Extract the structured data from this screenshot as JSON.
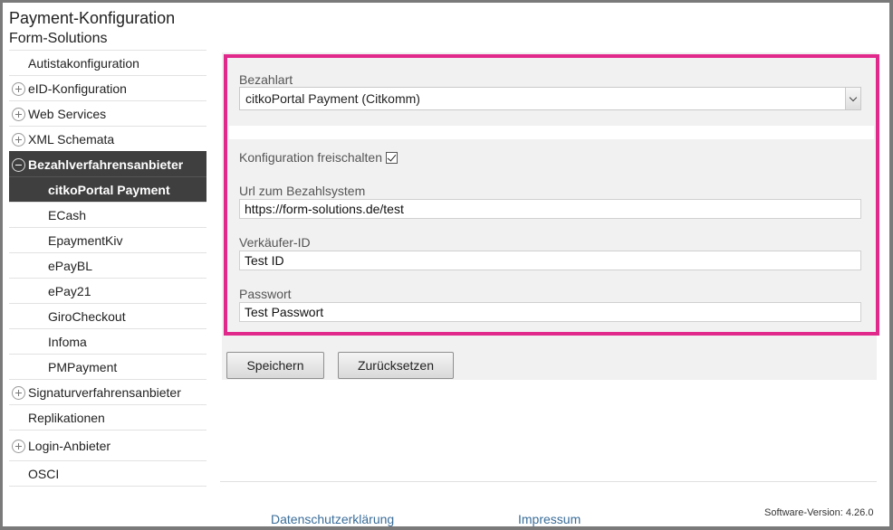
{
  "header": {
    "title": "Payment-Konfiguration",
    "subtitle": "Form-Solutions"
  },
  "sidebar": {
    "items": [
      {
        "label": "Autistakonfiguration"
      },
      {
        "label": "eID-Konfiguration",
        "icon": "plus-circle-icon"
      },
      {
        "label": "Web Services",
        "icon": "plus-circle-icon"
      },
      {
        "label": "XML Schemata",
        "icon": "plus-circle-icon"
      },
      {
        "label": "Bezahlverfahrensanbieter",
        "icon": "minus-circle-icon"
      },
      {
        "label": "citkoPortal Payment"
      },
      {
        "label": "ECash"
      },
      {
        "label": "EpaymentKiv"
      },
      {
        "label": "ePayBL"
      },
      {
        "label": "ePay21"
      },
      {
        "label": "GiroCheckout"
      },
      {
        "label": "Infoma"
      },
      {
        "label": "PMPayment"
      },
      {
        "label": "Signaturverfahrensanbieter",
        "icon": "plus-circle-icon"
      },
      {
        "label": "Replikationen"
      },
      {
        "label": "Login-Anbieter",
        "icon": "plus-circle-icon"
      },
      {
        "label": "OSCI"
      }
    ]
  },
  "form": {
    "bezahlart_label": "Bezahlart",
    "bezahlart_value": "citkoPortal Payment (Citkomm)",
    "freischalten_label": "Konfiguration freischalten",
    "freischalten_checked": true,
    "url_label": "Url zum Bezahlsystem",
    "url_value": "https://form-solutions.de/test",
    "verkaeufer_label": "Verkäufer-ID",
    "verkaeufer_value": "Test ID",
    "passwort_label": "Passwort",
    "passwort_value": "Test Passwort"
  },
  "buttons": {
    "save": "Speichern",
    "reset": "Zurücksetzen"
  },
  "footer": {
    "privacy": "Datenschutzerklärung",
    "imprint": "Impressum",
    "version": "Software-Version: 4.26.0"
  },
  "colors": {
    "highlight": "#e1298c",
    "active_nav": "#3f3f3f",
    "link": "#3a6d99"
  }
}
